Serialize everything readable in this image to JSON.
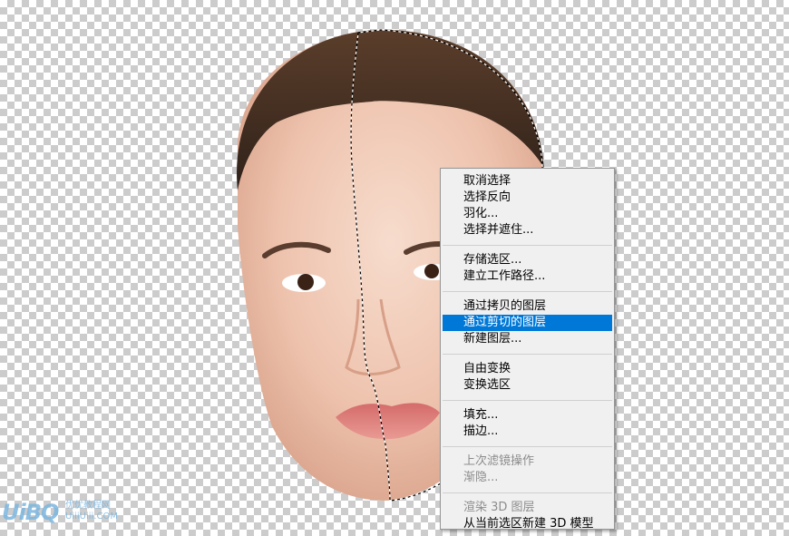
{
  "context_menu": {
    "items": [
      {
        "label": "取消选择",
        "enabled": true
      },
      {
        "label": "选择反向",
        "enabled": true
      },
      {
        "label": "羽化...",
        "enabled": true
      },
      {
        "label": "选择并遮住...",
        "enabled": true
      },
      {
        "label": "存储选区...",
        "enabled": true
      },
      {
        "label": "建立工作路径...",
        "enabled": true
      },
      {
        "label": "通过拷贝的图层",
        "enabled": true
      },
      {
        "label": "通过剪切的图层",
        "enabled": true,
        "highlighted": true
      },
      {
        "label": "新建图层...",
        "enabled": true
      },
      {
        "label": "自由变换",
        "enabled": true
      },
      {
        "label": "变换选区",
        "enabled": true
      },
      {
        "label": "填充...",
        "enabled": true
      },
      {
        "label": "描边...",
        "enabled": true
      },
      {
        "label": "上次滤镜操作",
        "enabled": false
      },
      {
        "label": "渐隐...",
        "enabled": false
      },
      {
        "label": "渲染 3D 图层",
        "enabled": false
      },
      {
        "label": "从当前选区新建 3D 模型",
        "enabled": true
      }
    ],
    "highlight_color": "#0078d7"
  },
  "watermark": {
    "logo_text": "UiBQ",
    "sub_text_1": "优优教程网",
    "sub_text_2": "UiiiUiii.COM"
  }
}
